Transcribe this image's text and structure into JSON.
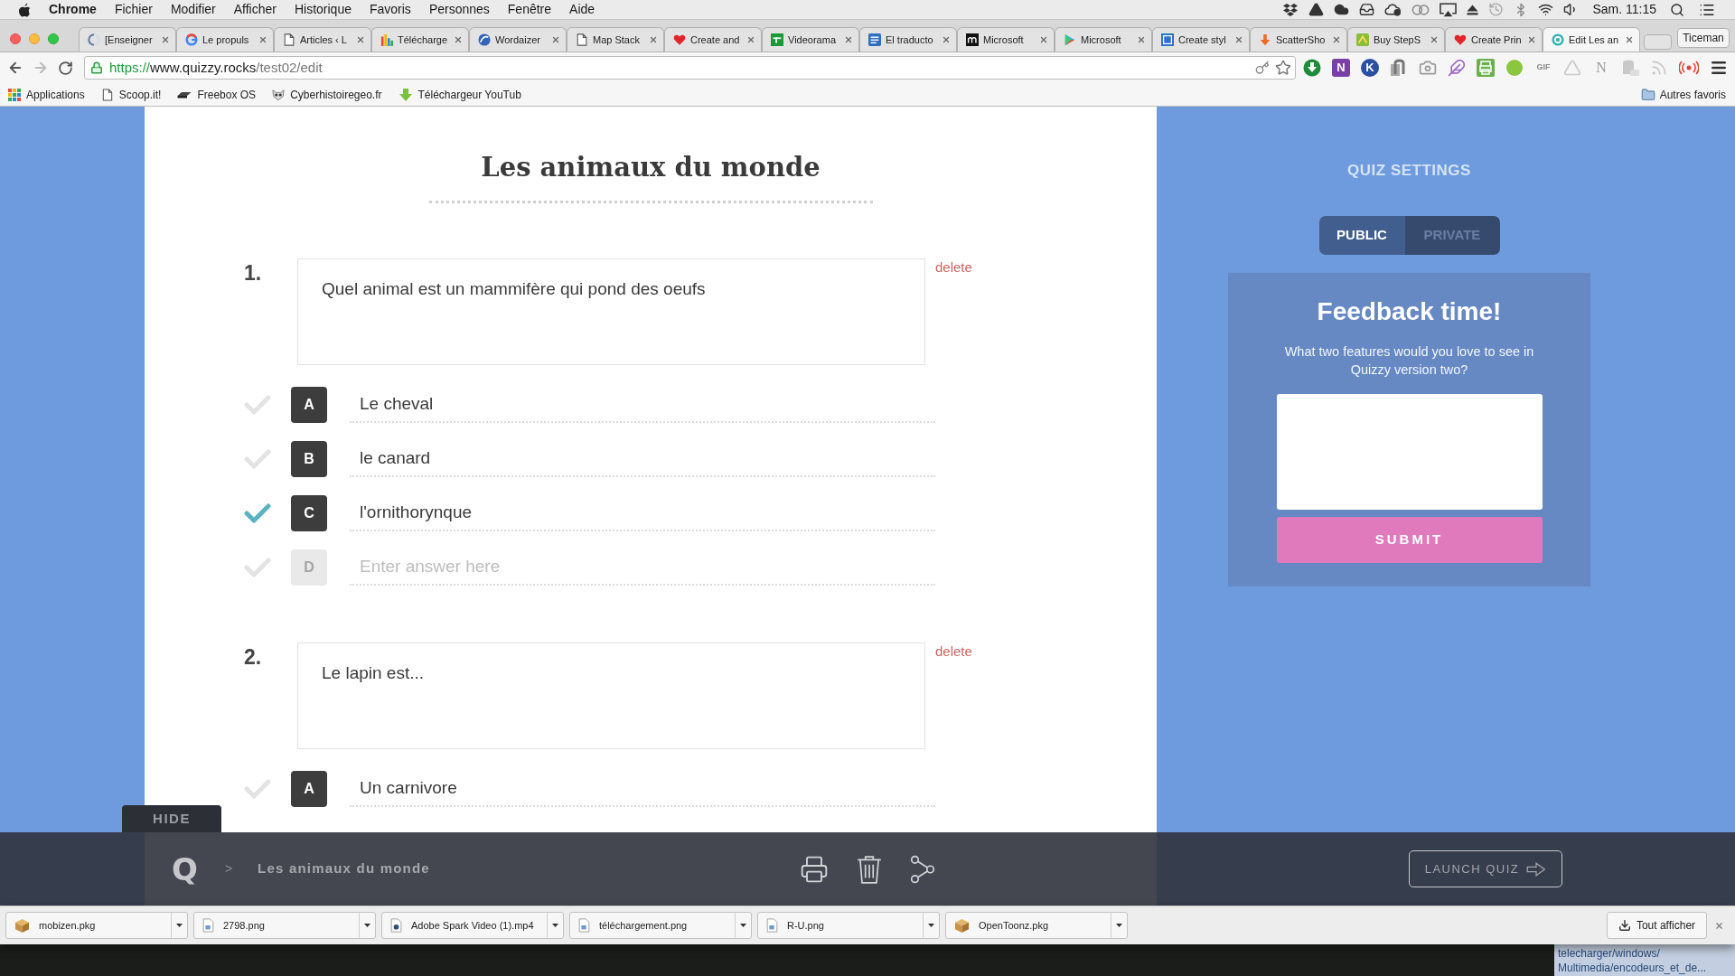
{
  "menu_bar": {
    "app": "Chrome",
    "items": [
      "Fichier",
      "Modifier",
      "Afficher",
      "Historique",
      "Favoris",
      "Personnes",
      "Fenêtre",
      "Aide"
    ],
    "clock": "Sam. 11:15"
  },
  "tabs": [
    {
      "title": "[Enseigner",
      "selected": false
    },
    {
      "title": "Le propuls",
      "selected": false
    },
    {
      "title": "Articles ‹ L",
      "selected": false
    },
    {
      "title": "Télécharge",
      "selected": false
    },
    {
      "title": "Wordaizer",
      "selected": false
    },
    {
      "title": "Map Stack",
      "selected": false
    },
    {
      "title": "Create and",
      "selected": false
    },
    {
      "title": "Videorama",
      "selected": false
    },
    {
      "title": "El traducto",
      "selected": false
    },
    {
      "title": "Microsoft",
      "selected": false
    },
    {
      "title": "Microsoft",
      "selected": false
    },
    {
      "title": "Create styl",
      "selected": false
    },
    {
      "title": "ScatterSho",
      "selected": false
    },
    {
      "title": "Buy StepS",
      "selected": false
    },
    {
      "title": "Create Prin",
      "selected": false
    },
    {
      "title": "Edit Les an",
      "selected": true
    }
  ],
  "profile": "Ticeman",
  "address_bar": {
    "scheme": "https://",
    "host": "www.quizzy.rocks",
    "path": "/test02/edit"
  },
  "extension_labels": [
    "N",
    "K",
    "GIF",
    "N"
  ],
  "bookmarks": [
    "Applications",
    "Scoop.it!",
    "Freebox OS",
    "Cyberhistoiregeo.fr",
    "Téléchargeur YouTub"
  ],
  "other_bookmarks": "Autres favoris",
  "quiz": {
    "title": "Les animaux du monde",
    "questions": [
      {
        "number": "1.",
        "text": "Quel animal est un mammifère qui pond des oeufs",
        "delete": "delete",
        "answers": [
          {
            "letter": "A",
            "text": "Le cheval",
            "correct": false
          },
          {
            "letter": "B",
            "text": "le canard",
            "correct": false
          },
          {
            "letter": "C",
            "text": "l'ornithorynque",
            "correct": true
          },
          {
            "letter": "D",
            "placeholder": "Enter answer here",
            "correct": false
          }
        ]
      },
      {
        "number": "2.",
        "text": "Le lapin est...",
        "delete": "delete",
        "answers": [
          {
            "letter": "A",
            "text": "Un carnivore",
            "correct": false
          }
        ]
      }
    ]
  },
  "settings": {
    "heading": "QUIZ SETTINGS",
    "visibility": [
      {
        "label": "PUBLIC",
        "selected": true
      },
      {
        "label": "PRIVATE",
        "selected": false
      }
    ]
  },
  "feedback": {
    "title": "Feedback time!",
    "prompt": "What two features would you love to see in Quizzy version two?",
    "submit": "SUBMIT"
  },
  "bottom_bar": {
    "hide": "HIDE",
    "logo": "Q",
    "separator": ">",
    "title": "Les animaux du monde",
    "launch": "LAUNCH QUIZ"
  },
  "downloads": [
    "mobizen.pkg",
    "2798.png",
    "Adobe Spark Video (1).mp4",
    "téléchargement.png",
    "R-U.png",
    "OpenToonz.pkg"
  ],
  "show_all": "Tout afficher",
  "status_bubble": [
    "telecharger/windows/",
    "Multimedia/encodeurs_et_de..."
  ]
}
